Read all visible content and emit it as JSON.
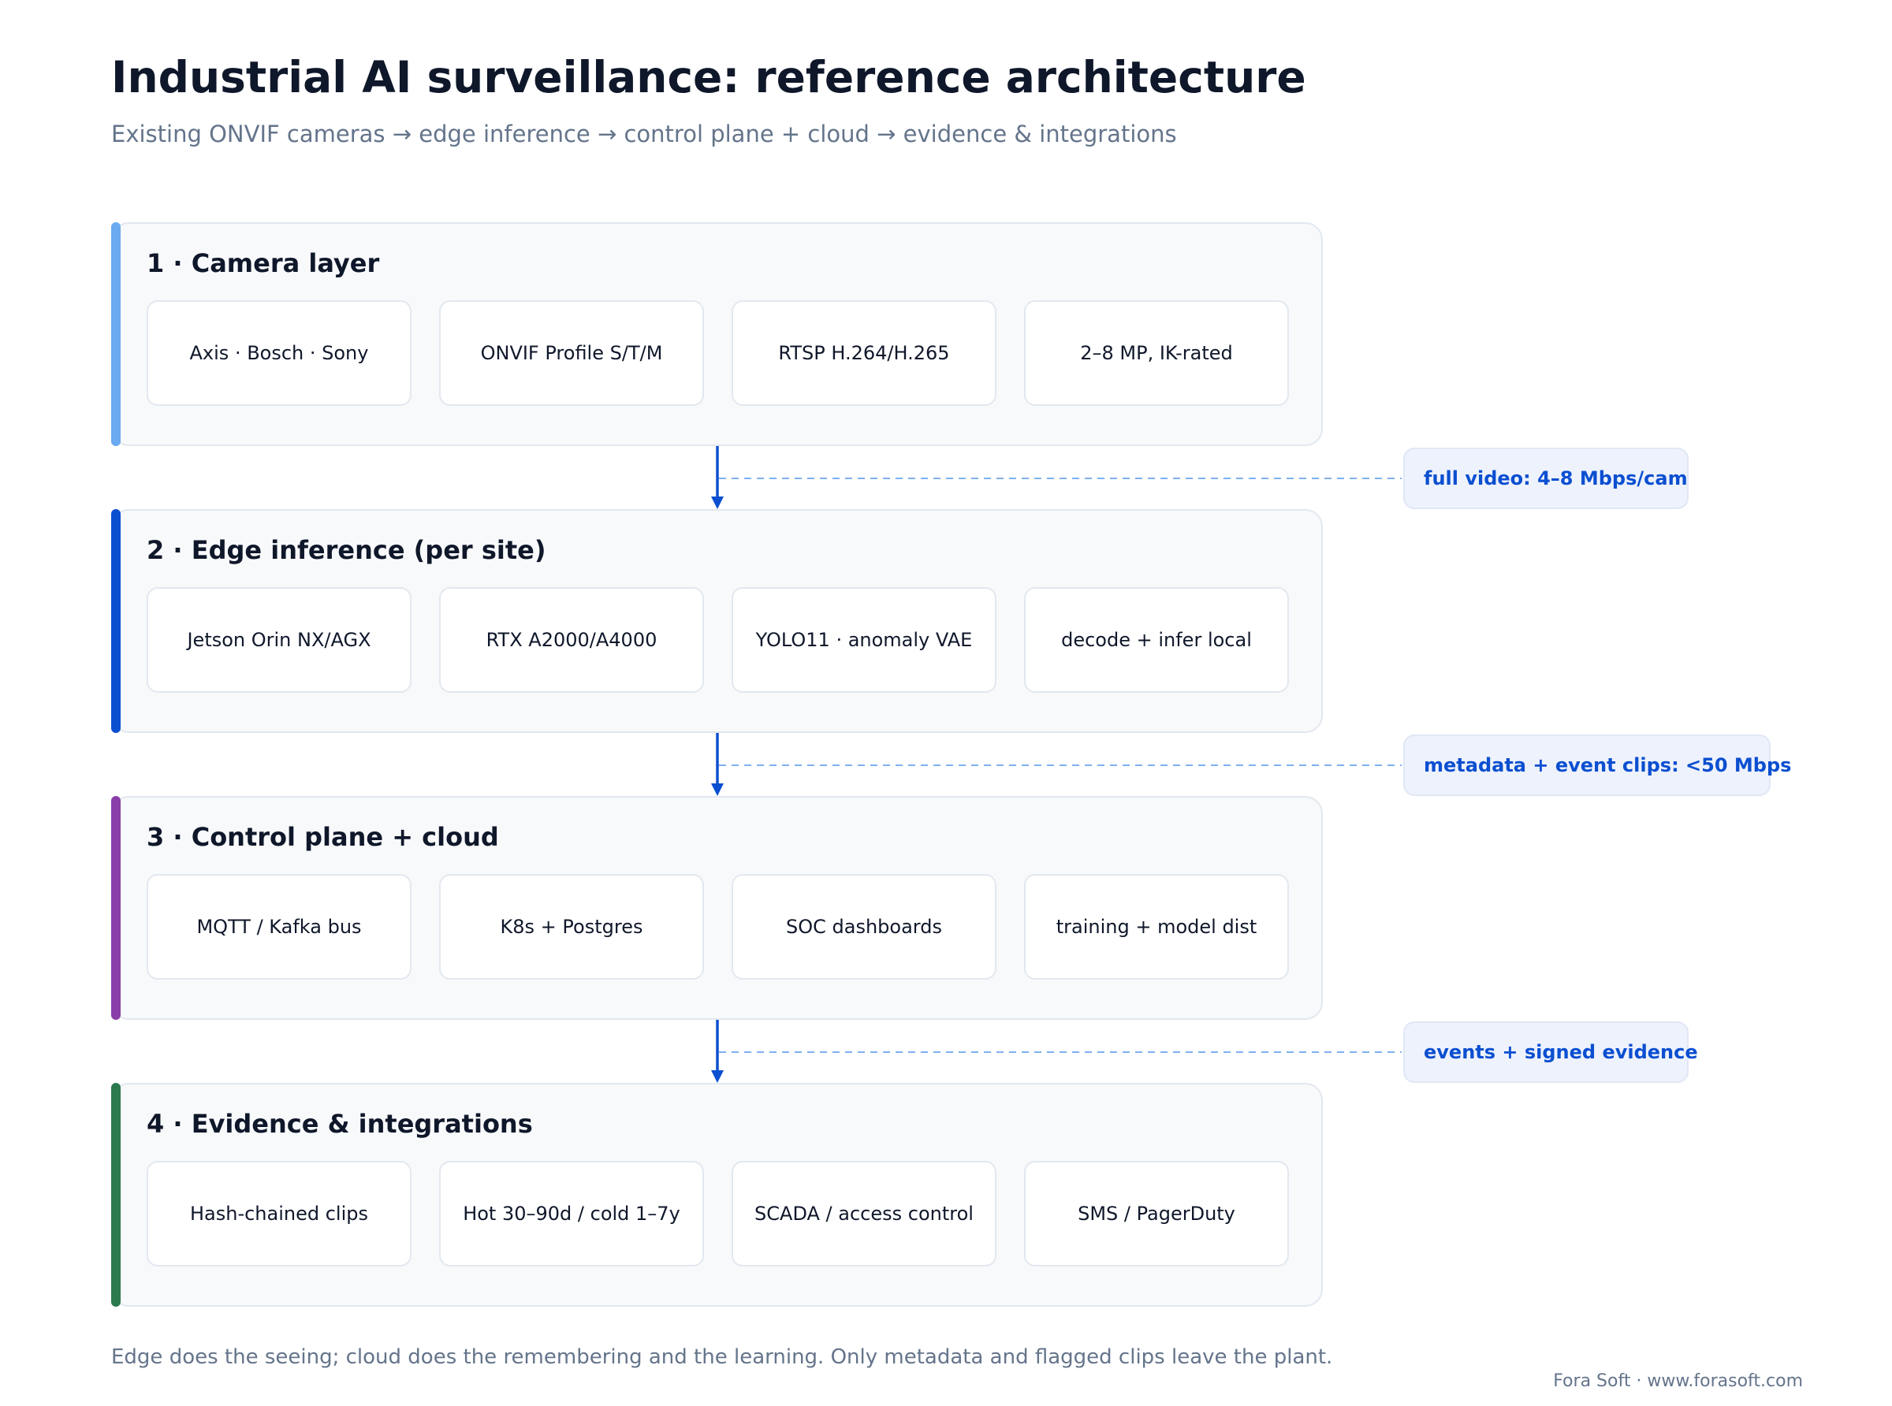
{
  "header": {
    "title": "Industrial AI surveillance: reference architecture",
    "subtitle": "Existing ONVIF cameras → edge inference → control plane + cloud → evidence & integrations"
  },
  "colors": {
    "accent_primary": "#0b4fd1",
    "connector_dashed": "#7fb0f0",
    "layer_1_accent": "#6aaaf0",
    "layer_2_accent": "#0b4fd1",
    "layer_3_accent": "#8a3ea8",
    "layer_4_accent": "#2a7a4e"
  },
  "layers": [
    {
      "title": "1 · Camera layer",
      "items": [
        "Axis · Bosch · Sony",
        "ONVIF Profile S/T/M",
        "RTSP H.264/H.265",
        "2–8 MP, IK-rated"
      ]
    },
    {
      "title": "2 · Edge inference (per site)",
      "items": [
        "Jetson Orin NX/AGX",
        "RTX A2000/A4000",
        "YOLO11 · anomaly VAE",
        "decode + infer local"
      ]
    },
    {
      "title": "3 · Control plane + cloud",
      "items": [
        "MQTT / Kafka bus",
        "K8s + Postgres",
        "SOC dashboards",
        "training + model dist"
      ]
    },
    {
      "title": "4 · Evidence & integrations",
      "items": [
        "Hash-chained clips",
        "Hot 30–90d / cold 1–7y",
        "SCADA / access control",
        "SMS / PagerDuty"
      ]
    }
  ],
  "flows": [
    {
      "label": "full video: 4–8 Mbps/cam"
    },
    {
      "label": "metadata + event clips: <50 Mbps"
    },
    {
      "label": "events + signed evidence"
    }
  ],
  "footer": {
    "note": "Edge does the seeing; cloud does the remembering and the learning. Only metadata and flagged clips leave the plant.",
    "credit": "Fora Soft · www.forasoft.com"
  }
}
